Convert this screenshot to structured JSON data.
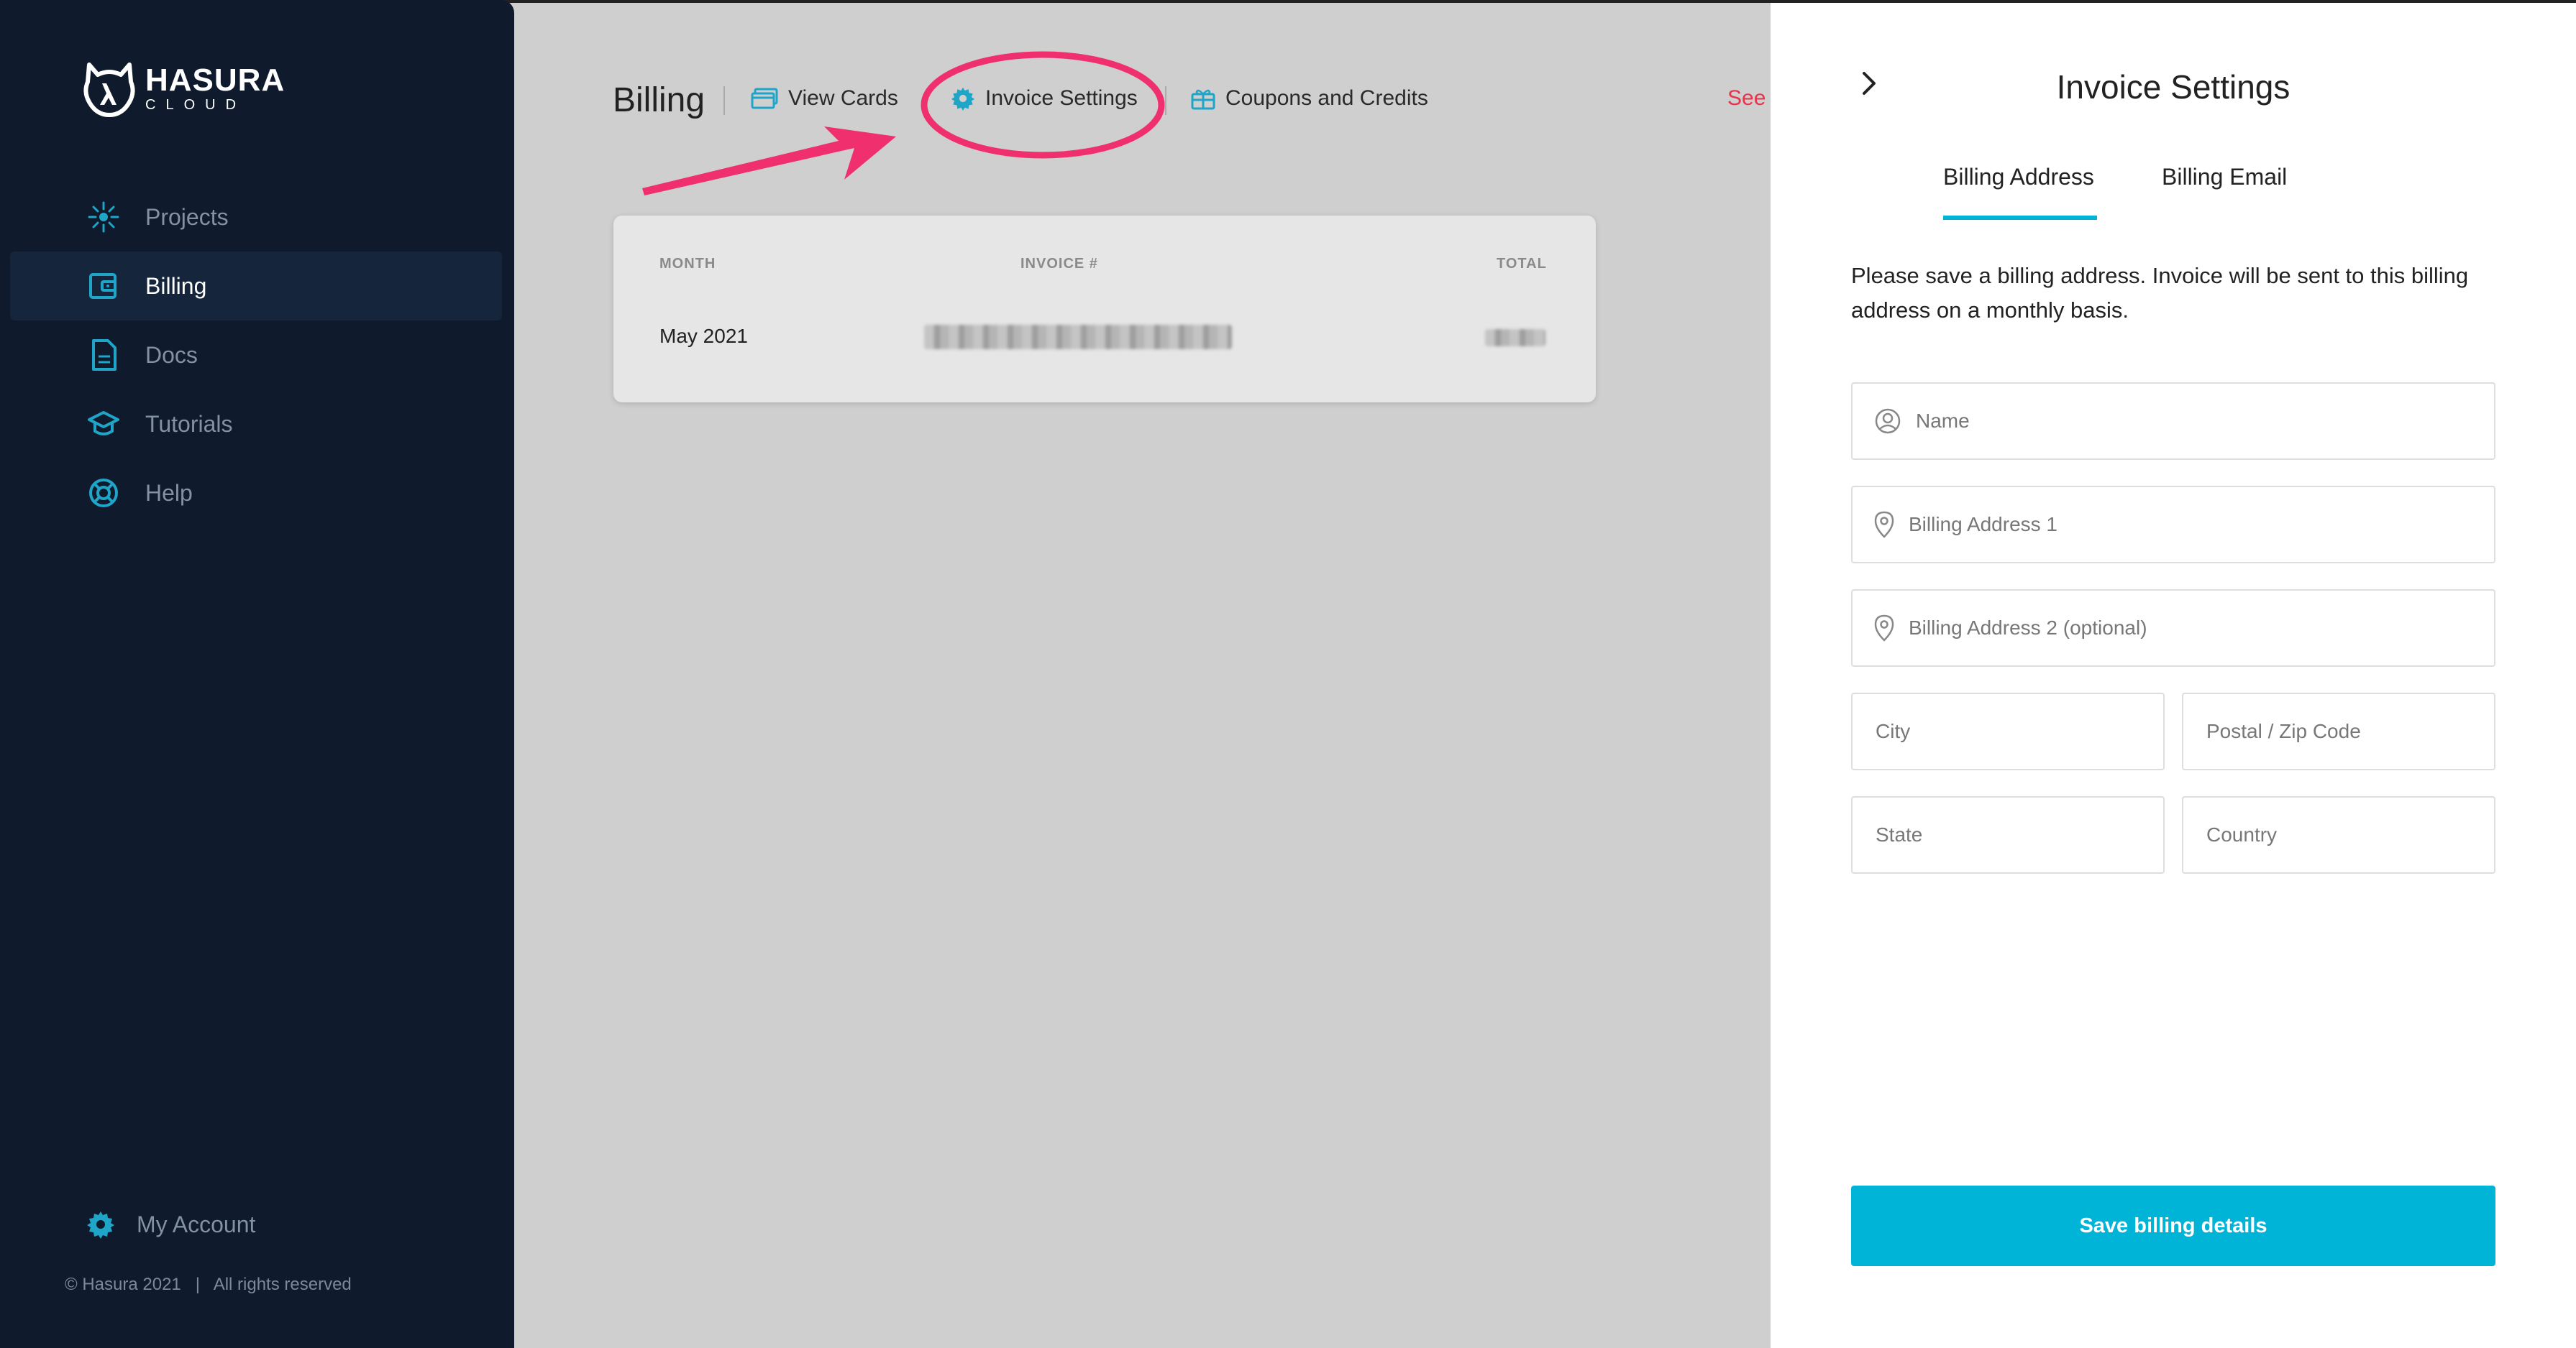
{
  "brand": {
    "title": "HASURA",
    "subtitle": "CLOUD"
  },
  "sidebar": {
    "items": [
      {
        "label": "Projects",
        "icon": "projects-icon",
        "active": false
      },
      {
        "label": "Billing",
        "icon": "billing-icon",
        "active": true
      },
      {
        "label": "Docs",
        "icon": "docs-icon",
        "active": false
      },
      {
        "label": "Tutorials",
        "icon": "tutorials-icon",
        "active": false
      },
      {
        "label": "Help",
        "icon": "help-icon",
        "active": false
      }
    ],
    "account_label": "My Account",
    "copyright": "© Hasura 2021   |   All rights reserved"
  },
  "main": {
    "title": "Billing",
    "tabs": [
      {
        "label": "View Cards",
        "icon": "card-icon"
      },
      {
        "label": "Invoice Settings",
        "icon": "gear-icon"
      },
      {
        "label": "Coupons and Credits",
        "icon": "gift-icon"
      }
    ],
    "see_link": "See",
    "table": {
      "headers": [
        "MONTH",
        "INVOICE #",
        "TOTAL"
      ],
      "rows": [
        {
          "month": "May 2021"
        }
      ]
    }
  },
  "panel": {
    "title": "Invoice Settings",
    "tabs": [
      "Billing Address",
      "Billing Email"
    ],
    "active_tab": "Billing Address",
    "description": "Please save a billing address. Invoice will be sent to this billing address on a monthly basis.",
    "fields": {
      "name": "Name",
      "address1": "Billing Address 1",
      "address2": "Billing Address 2 (optional)",
      "city": "City",
      "zip": "Postal / Zip Code",
      "state": "State",
      "country": "Country"
    },
    "save_label": "Save billing details"
  },
  "colors": {
    "accent": "#00b4d8",
    "sidebar": "#0f1b2d",
    "annotation": "#f0306e",
    "link_red": "#e8334a"
  }
}
